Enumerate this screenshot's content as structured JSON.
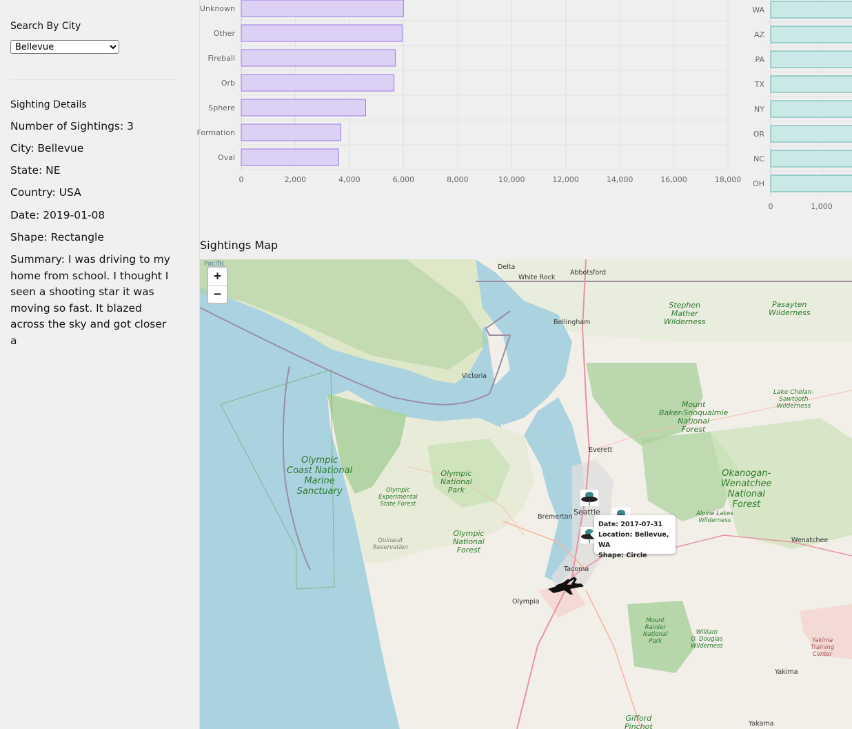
{
  "sidebar": {
    "search_title": "Search By City",
    "selected_city": "Bellevue",
    "details_title": "Sighting Details",
    "count": "Number of Sightings: 3",
    "city": "City: Bellevue",
    "state": "State: NE",
    "country": "Country: USA",
    "date": "Date: 2019-01-08",
    "shape": "Shape: Rectangle",
    "summary": "Summary: I was driving to my home from school. I thought I seen a shooting star it was moving so fast. It blazed across the sky and got closer a"
  },
  "chart_data": [
    {
      "type": "bar",
      "orientation": "horizontal",
      "categories": [
        "Unknown",
        "Other",
        "Fireball",
        "Orb",
        "Sphere",
        "Formation",
        "Oval"
      ],
      "values": [
        6000,
        5950,
        5700,
        5650,
        4600,
        3680,
        3600
      ],
      "xlim": [
        0,
        18000
      ],
      "xticks": [
        "0",
        "2,000",
        "4,000",
        "6,000",
        "8,000",
        "10,000",
        "12,000",
        "14,000",
        "16,000",
        "18,000"
      ],
      "grid": true,
      "color": "#dcd0f5",
      "border_color": "#9b7ae6"
    },
    {
      "type": "bar",
      "orientation": "horizontal",
      "categories": [
        "WA",
        "AZ",
        "PA",
        "TX",
        "NY",
        "OR",
        "NC",
        "OH"
      ],
      "values": [
        null,
        null,
        null,
        null,
        null,
        null,
        null,
        null
      ],
      "xticks": [
        "0",
        "1,000"
      ],
      "grid": true,
      "color": "#c9e8e6",
      "border_color": "#5fb5ac"
    }
  ],
  "map": {
    "title": "Sightings Map",
    "zoom_in": "+",
    "zoom_out": "−",
    "popup": {
      "date": "Date: 2017-07-31",
      "location": "Location: Bellevue, WA",
      "shape": "Shape: Circle"
    },
    "labels": {
      "delta": "Delta",
      "white_rock": "White Rock",
      "abbotsford": "Abbotsford",
      "bellingham": "Bellingham",
      "victoria": "Victoria",
      "everett": "Everett",
      "seattle": "Seattle",
      "bremerton": "Bremerton",
      "tacoma": "Tacoma",
      "olympia": "Olympia",
      "wenatchee": "Wenatchee",
      "yakima": "Yakima",
      "yakima_bottom": "Yakama",
      "pacific": "Pacific",
      "stephen_mather": "Stephen\nMather\nWilderness",
      "pasayten": "Pasayten\nWilderness",
      "lake_chelan": "Lake Chelan-\nSawtooth\nWilderness",
      "mount_baker": "Mount\nBaker-Snoqualmie\nNational\nForest",
      "okanogan": "Okanogan-\nWenatchee\nNational\nForest",
      "olympic_coast": "Olympic\nCoast National\nMarine\nSanctuary",
      "olympic_np": "Olympic\nNational\nPark",
      "olympic_nf": "Olympic\nNational\nForest",
      "olympic_exp": "Olympic\nExperimental\nState Forest",
      "quinault": "Quinault\nReservation",
      "alpine_lakes": "Alpine Lakes\nWilderness",
      "mount_rainier": "Mount\nRainier\nNational\nPark",
      "william_douglas": "William\nO. Douglas\nWilderness",
      "yakima_training": "Yakima\nTraining\nCenter",
      "gifford": "Gifford\nPinchot"
    },
    "icons": [
      "ufo-marker-icon",
      "jet-marker-icon"
    ]
  }
}
